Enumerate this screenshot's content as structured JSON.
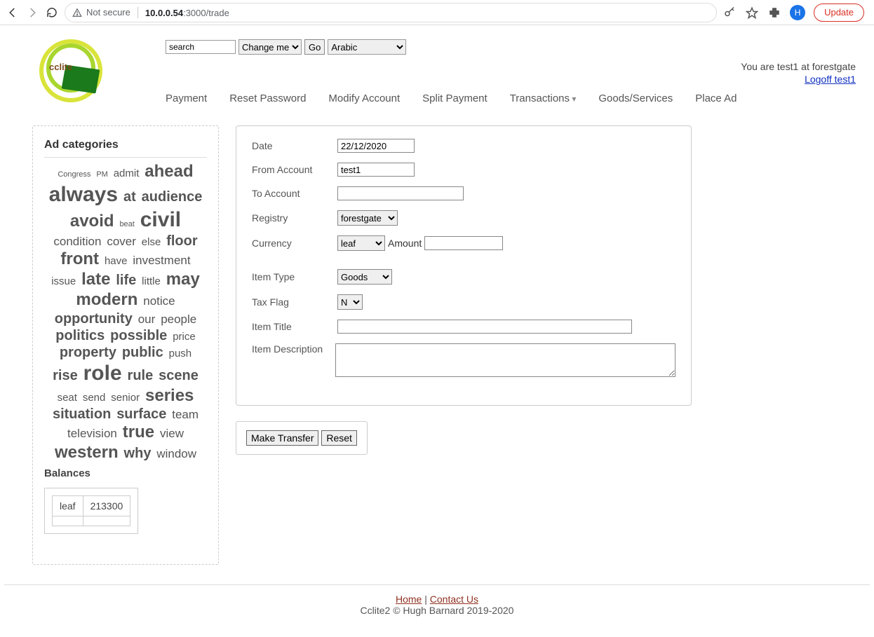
{
  "chrome": {
    "not_secure": "Not secure",
    "host": "10.0.0.54",
    "port_path": ":3000/trade",
    "avatar_letter": "H",
    "update": "Update"
  },
  "header": {
    "logo_text": "cclite",
    "search_value": "search",
    "sort_select": "Change me",
    "go": "Go",
    "lang_select": "Arabic",
    "user_status": "You are test1 at forestgate",
    "logoff": "Logoff test1",
    "nav": {
      "payment": "Payment",
      "reset_password": "Reset Password",
      "modify_account": "Modify Account",
      "split_payment": "Split Payment",
      "transactions": "Transactions",
      "goods_services": "Goods/Services",
      "place_ad": "Place Ad"
    }
  },
  "sidebar": {
    "title": "Ad categories",
    "tags": [
      {
        "t": "Congress",
        "s": 1
      },
      {
        "t": "PM",
        "s": 1
      },
      {
        "t": "admit",
        "s": 3
      },
      {
        "t": "ahead",
        "s": 6
      },
      {
        "t": "always",
        "s": 7
      },
      {
        "t": "at",
        "s": 5
      },
      {
        "t": "audience",
        "s": 5
      },
      {
        "t": "avoid",
        "s": 6
      },
      {
        "t": "beat",
        "s": 1
      },
      {
        "t": "civil",
        "s": 7
      },
      {
        "t": "condition",
        "s": 4
      },
      {
        "t": "cover",
        "s": 4
      },
      {
        "t": "else",
        "s": 3
      },
      {
        "t": "floor",
        "s": 5
      },
      {
        "t": "front",
        "s": 6
      },
      {
        "t": "have",
        "s": 3
      },
      {
        "t": "investment",
        "s": 4
      },
      {
        "t": "issue",
        "s": 3
      },
      {
        "t": "late",
        "s": 6
      },
      {
        "t": "life",
        "s": 5
      },
      {
        "t": "little",
        "s": 3
      },
      {
        "t": "may",
        "s": 6
      },
      {
        "t": "modern",
        "s": 6
      },
      {
        "t": "notice",
        "s": 4
      },
      {
        "t": "opportunity",
        "s": 5
      },
      {
        "t": "our",
        "s": 4
      },
      {
        "t": "people",
        "s": 4
      },
      {
        "t": "politics",
        "s": 5
      },
      {
        "t": "possible",
        "s": 5
      },
      {
        "t": "price",
        "s": 3
      },
      {
        "t": "property",
        "s": 5
      },
      {
        "t": "public",
        "s": 5
      },
      {
        "t": "push",
        "s": 3
      },
      {
        "t": "rise",
        "s": 5
      },
      {
        "t": "role",
        "s": 7
      },
      {
        "t": "rule",
        "s": 5
      },
      {
        "t": "scene",
        "s": 5
      },
      {
        "t": "seat",
        "s": 3
      },
      {
        "t": "send",
        "s": 3
      },
      {
        "t": "senior",
        "s": 3
      },
      {
        "t": "series",
        "s": 6
      },
      {
        "t": "situation",
        "s": 5
      },
      {
        "t": "surface",
        "s": 5
      },
      {
        "t": "team",
        "s": 4
      },
      {
        "t": "television",
        "s": 4
      },
      {
        "t": "true",
        "s": 6
      },
      {
        "t": "view",
        "s": 4
      },
      {
        "t": "western",
        "s": 6
      },
      {
        "t": "why",
        "s": 5
      },
      {
        "t": "window",
        "s": 4
      }
    ],
    "balances_title": "Balances",
    "balances": {
      "currency": "leaf",
      "amount": "213300"
    }
  },
  "form": {
    "labels": {
      "date": "Date",
      "from": "From Account",
      "to": "To Account",
      "registry": "Registry",
      "currency": "Currency",
      "amount": "Amount",
      "item_type": "Item Type",
      "tax_flag": "Tax Flag",
      "item_title": "Item Title",
      "item_desc": "Item Description"
    },
    "values": {
      "date": "22/12/2020",
      "from": "test1",
      "to": "",
      "registry": "forestgate",
      "currency": "leaf",
      "amount": "",
      "item_type": "Goods",
      "tax_flag": "N",
      "item_title": "",
      "item_desc": ""
    },
    "buttons": {
      "submit": "Make Transfer",
      "reset": "Reset"
    }
  },
  "footer": {
    "home": "Home",
    "sep": " | ",
    "contact": "Contact Us",
    "copyright": "Cclite2 © Hugh Barnard 2019-2020"
  }
}
